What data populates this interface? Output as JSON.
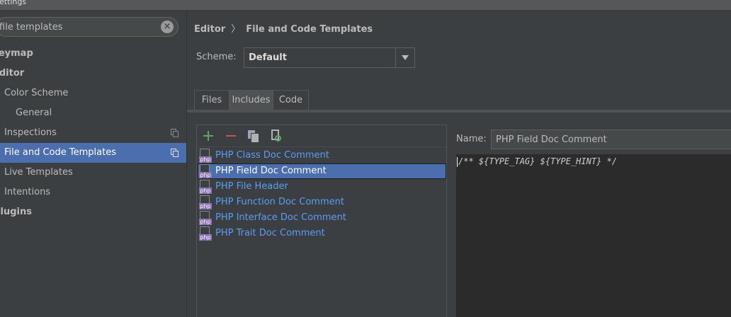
{
  "window": {
    "title": "Settings"
  },
  "search": {
    "value": "file templates",
    "clear_icon": "clear-icon"
  },
  "sidebar": {
    "items": [
      {
        "label": "Keymap"
      },
      {
        "label": "Editor"
      },
      {
        "label": "Color Scheme"
      },
      {
        "label": "General"
      },
      {
        "label": "Inspections"
      },
      {
        "label": "File and Code Templates"
      },
      {
        "label": "Live Templates"
      },
      {
        "label": "Intentions"
      },
      {
        "label": "Plugins"
      }
    ]
  },
  "breadcrumb": {
    "parent": "Editor",
    "separator": "〉",
    "current": "File and Code Templates"
  },
  "scheme": {
    "label": "Scheme:",
    "value": "Default"
  },
  "tabs": [
    {
      "label": "Files"
    },
    {
      "label": "Includes",
      "selected": true
    },
    {
      "label": "Code"
    }
  ],
  "toolbar": {
    "icons": [
      "add-icon",
      "remove-icon",
      "copy-icon",
      "reset-icon"
    ]
  },
  "templates": [
    {
      "label": "PHP Class Doc Comment"
    },
    {
      "label": "PHP Field Doc Comment",
      "selected": true
    },
    {
      "label": "PHP File Header"
    },
    {
      "label": "PHP Function Doc Comment"
    },
    {
      "label": "PHP Interface Doc Comment"
    },
    {
      "label": "PHP Trait Doc Comment"
    }
  ],
  "php_badge": "php",
  "name": {
    "label": "Name:",
    "value": "PHP Field Doc Comment"
  },
  "editor": {
    "content": "/** ${TYPE_TAG} ${TYPE_HINT} */"
  },
  "colors": {
    "selection": "#4b6eaf",
    "link": "#589df6",
    "background": "#3c3f41",
    "editor_bg": "#2b2b2b"
  }
}
